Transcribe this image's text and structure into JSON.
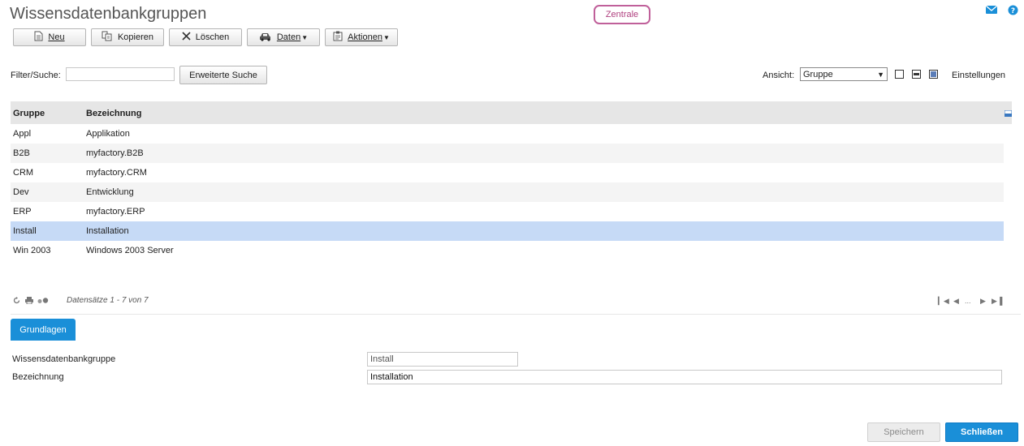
{
  "page": {
    "title": "Wissensdatenbankgruppen",
    "badge": "Zentrale"
  },
  "toolbar": {
    "new": "Neu",
    "copy": "Kopieren",
    "delete": "Löschen",
    "data": "Daten",
    "actions": "Aktionen"
  },
  "filter": {
    "label": "Filter/Suche:",
    "value": "",
    "advanced_search": "Erweiterte Suche"
  },
  "view": {
    "label": "Ansicht:",
    "selected": "Gruppe",
    "settings": "Einstellungen"
  },
  "grid": {
    "columns": [
      "Gruppe",
      "Bezeichnung"
    ],
    "rows": [
      [
        "Appl",
        "Applikation"
      ],
      [
        "B2B",
        "myfactory.B2B"
      ],
      [
        "CRM",
        "myfactory.CRM"
      ],
      [
        "Dev",
        "Entwicklung"
      ],
      [
        "ERP",
        "myfactory.ERP"
      ],
      [
        "Install",
        "Installation"
      ],
      [
        "Win 2003",
        "Windows 2003 Server"
      ]
    ],
    "selected_row": 5,
    "records_text": "Datensätze 1 - 7 von 7",
    "pager_ellipsis": "..."
  },
  "tabs": {
    "basics": "Grundlagen"
  },
  "form": {
    "group_label": "Wissensdatenbankgruppe",
    "group_value": "Install",
    "desc_label": "Bezeichnung",
    "desc_value": "Installation"
  },
  "buttons": {
    "save": "Speichern",
    "close": "Schließen"
  },
  "colors": {
    "accent": "#1a8fd8",
    "selection": "#c6daf6",
    "badge_border": "#c0609a"
  }
}
